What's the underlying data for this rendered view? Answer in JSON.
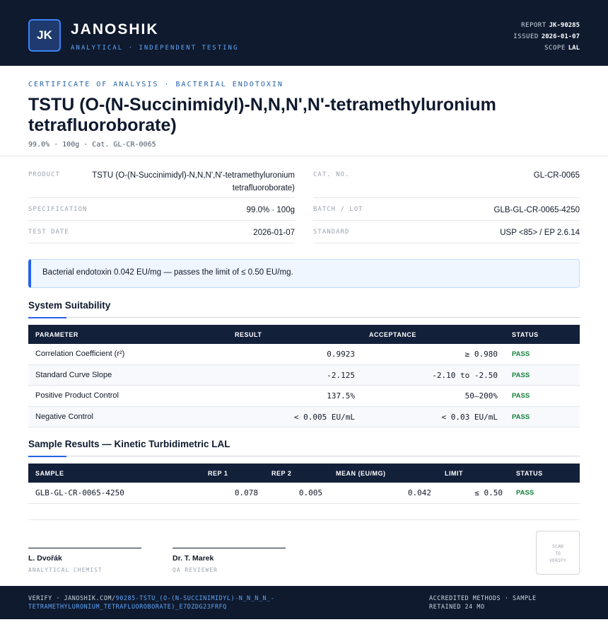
{
  "header": {
    "logo_initials": "JK",
    "brand_name": "JANOSHIK",
    "brand_tagline": "ANALYTICAL · INDEPENDENT TESTING",
    "report_label": "REPORT",
    "report_value": "JK-90285",
    "issued_label": "ISSUED",
    "issued_value": "2026-01-07",
    "scope_label": "SCOPE",
    "scope_value": "LAL"
  },
  "title_block": {
    "eyebrow": "CERTIFICATE OF ANALYSIS · BACTERIAL ENDOTOXIN",
    "title": "TSTU (O-(N-Succinimidyl)-N,N,N',N'-tetramethyluronium tetrafluoroborate)",
    "subline": "99.0% · 100g  ·  Cat. GL-CR-0065"
  },
  "info": {
    "product_label": "PRODUCT",
    "product_value": "TSTU (O-(N-Succinimidyl)-N,N,N',N'-tetramethyluronium tetrafluoroborate)",
    "spec_label": "SPECIFICATION",
    "spec_value": "99.0% · 100g",
    "test_date_label": "TEST DATE",
    "test_date_value": "2026-01-07",
    "cat_label": "CAT. NO.",
    "cat_value": "GL-CR-0065",
    "batch_label": "BATCH / LOT",
    "batch_value": "GLB-GL-CR-0065-4250",
    "standard_label": "STANDARD",
    "standard_value": "USP <85> / EP 2.6.14"
  },
  "callout": "Bacterial endotoxin 0.042 EU/mg — passes the limit of ≤ 0.50 EU/mg.",
  "suitability": {
    "title": "System Suitability",
    "headers": [
      "PARAMETER",
      "RESULT",
      "ACCEPTANCE",
      "STATUS"
    ],
    "rows": [
      {
        "parameter": "Correlation Coefficient (r²)",
        "result": "0.9923",
        "acceptance": "≥ 0.980",
        "status": "PASS"
      },
      {
        "parameter": "Standard Curve Slope",
        "result": "-2.125",
        "acceptance": "-2.10 to -2.50",
        "status": "PASS"
      },
      {
        "parameter": "Positive Product Control",
        "result": "137.5%",
        "acceptance": "50–200%",
        "status": "PASS"
      },
      {
        "parameter": "Negative Control",
        "result": "< 0.005 EU/mL",
        "acceptance": "< 0.03 EU/mL",
        "status": "PASS"
      }
    ]
  },
  "samples": {
    "title": "Sample Results — Kinetic Turbidimetric LAL",
    "headers": [
      "SAMPLE",
      "REP 1",
      "REP 2",
      "MEAN (EU/MG)",
      "LIMIT",
      "STATUS"
    ],
    "rows": [
      {
        "sample": "GLB-GL-CR-0065-4250",
        "rep1": "0.078",
        "rep2": "0.005",
        "mean": "0.042",
        "limit": "≤ 0.50",
        "status": "PASS"
      }
    ]
  },
  "signatures": [
    {
      "name": "L. Dvořák",
      "role": "ANALYTICAL CHEMIST"
    },
    {
      "name": "Dr. T. Marek",
      "role": "QA REVIEWER"
    }
  ],
  "qr_text": [
    "SCAN",
    "TO",
    "VERIFY"
  ],
  "footer": {
    "verify_prefix": "VERIFY · JANOSHIK.COM/",
    "verify_link": "90285-TSTU_(O-(N-SUCCINIMIDYL)-N_N_N_N_-TETRAMETHYLURONIUM_TETRAFLUOROBORATE)_E7DZDG23FRFQ",
    "right_text": "ACCREDITED METHODS · SAMPLE RETAINED 24 MO"
  },
  "colors": {
    "navy": "#0f1a2e",
    "accent_blue": "#2563eb",
    "pass_green": "#15803d"
  }
}
